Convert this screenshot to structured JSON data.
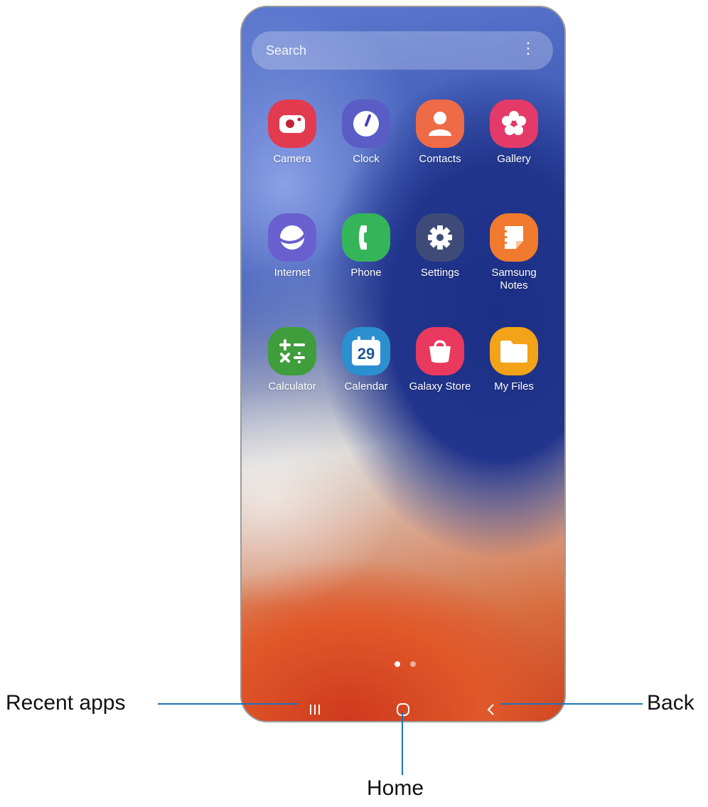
{
  "search": {
    "placeholder": "Search",
    "menu_icon": "more-vert-icon"
  },
  "apps": [
    {
      "label": "Camera",
      "icon": "camera-icon",
      "color": "#e23a4f"
    },
    {
      "label": "Clock",
      "icon": "clock-icon",
      "color": "#5a5dc6"
    },
    {
      "label": "Contacts",
      "icon": "contacts-icon",
      "color": "#ef6a46"
    },
    {
      "label": "Gallery",
      "icon": "gallery-icon",
      "color": "#e33a6a"
    },
    {
      "label": "Internet",
      "icon": "internet-icon",
      "color": "#6a5fcf"
    },
    {
      "label": "Phone",
      "icon": "phone-icon",
      "color": "#35b55a"
    },
    {
      "label": "Settings",
      "icon": "settings-icon",
      "color": "#3e4b78"
    },
    {
      "label": "Samsung Notes",
      "icon": "notes-icon",
      "color": "#f07a2e"
    },
    {
      "label": "Calculator",
      "icon": "calculator-icon",
      "color": "#3f9d3c"
    },
    {
      "label": "Calendar",
      "icon": "calendar-icon",
      "color": "#2c8fd0",
      "day": "29"
    },
    {
      "label": "Galaxy Store",
      "icon": "store-icon",
      "color": "#e9395f"
    },
    {
      "label": "My Files",
      "icon": "folder-icon",
      "color": "#f3a318"
    }
  ],
  "page_indicator": {
    "count": 2,
    "active": 1
  },
  "navigation": {
    "recent": "recent-apps-icon",
    "home": "home-icon",
    "back": "back-icon"
  },
  "callouts": {
    "recent_apps": "Recent apps",
    "home": "Home",
    "back": "Back"
  },
  "colors": {
    "callout_line": "#1f73b7"
  }
}
